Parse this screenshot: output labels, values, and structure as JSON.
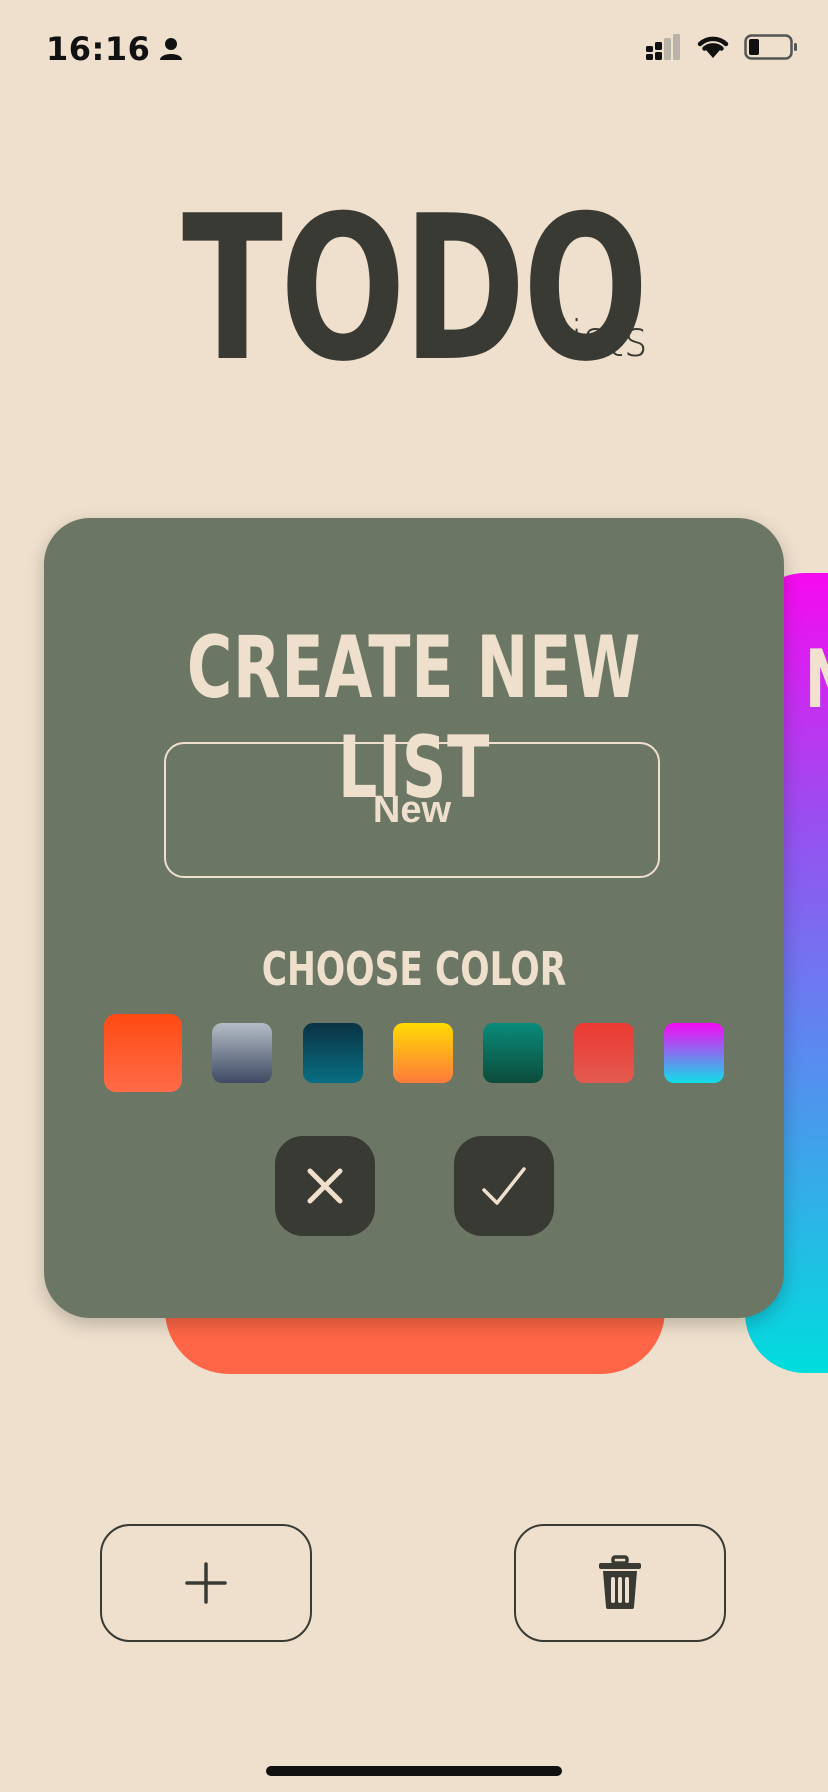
{
  "status_bar": {
    "time": "16:16"
  },
  "logo": {
    "main": "TODO",
    "sub": "lists"
  },
  "background_cards": {
    "right_card_letter": "N"
  },
  "modal": {
    "title": "CREATE NEW LIST",
    "name_input": {
      "value": "New"
    },
    "choose_color_label": "CHOOSE COLOR",
    "colors": [
      {
        "id": "orange",
        "selected": true,
        "from": "#FF4A12",
        "to": "#FF6A48"
      },
      {
        "id": "slate",
        "selected": false,
        "from": "#B4BDC6",
        "to": "#3E4A63"
      },
      {
        "id": "petrol",
        "selected": false,
        "from": "#0A3244",
        "to": "#096E82"
      },
      {
        "id": "sunrise",
        "selected": false,
        "from": "#FFDA02",
        "to": "#FF7A3C"
      },
      {
        "id": "teal",
        "selected": false,
        "from": "#0A8B7A",
        "to": "#0C4B3A"
      },
      {
        "id": "red",
        "selected": false,
        "from": "#EB3A32",
        "to": "#E35A50"
      },
      {
        "id": "magenta-cyan",
        "selected": false,
        "from": "#F607F5",
        "to": "#10E0E8"
      }
    ],
    "cancel_icon": "close-icon",
    "confirm_icon": "checkmark-icon"
  },
  "bottom_bar": {
    "add_icon": "plus-icon",
    "delete_icon": "trash-icon"
  }
}
